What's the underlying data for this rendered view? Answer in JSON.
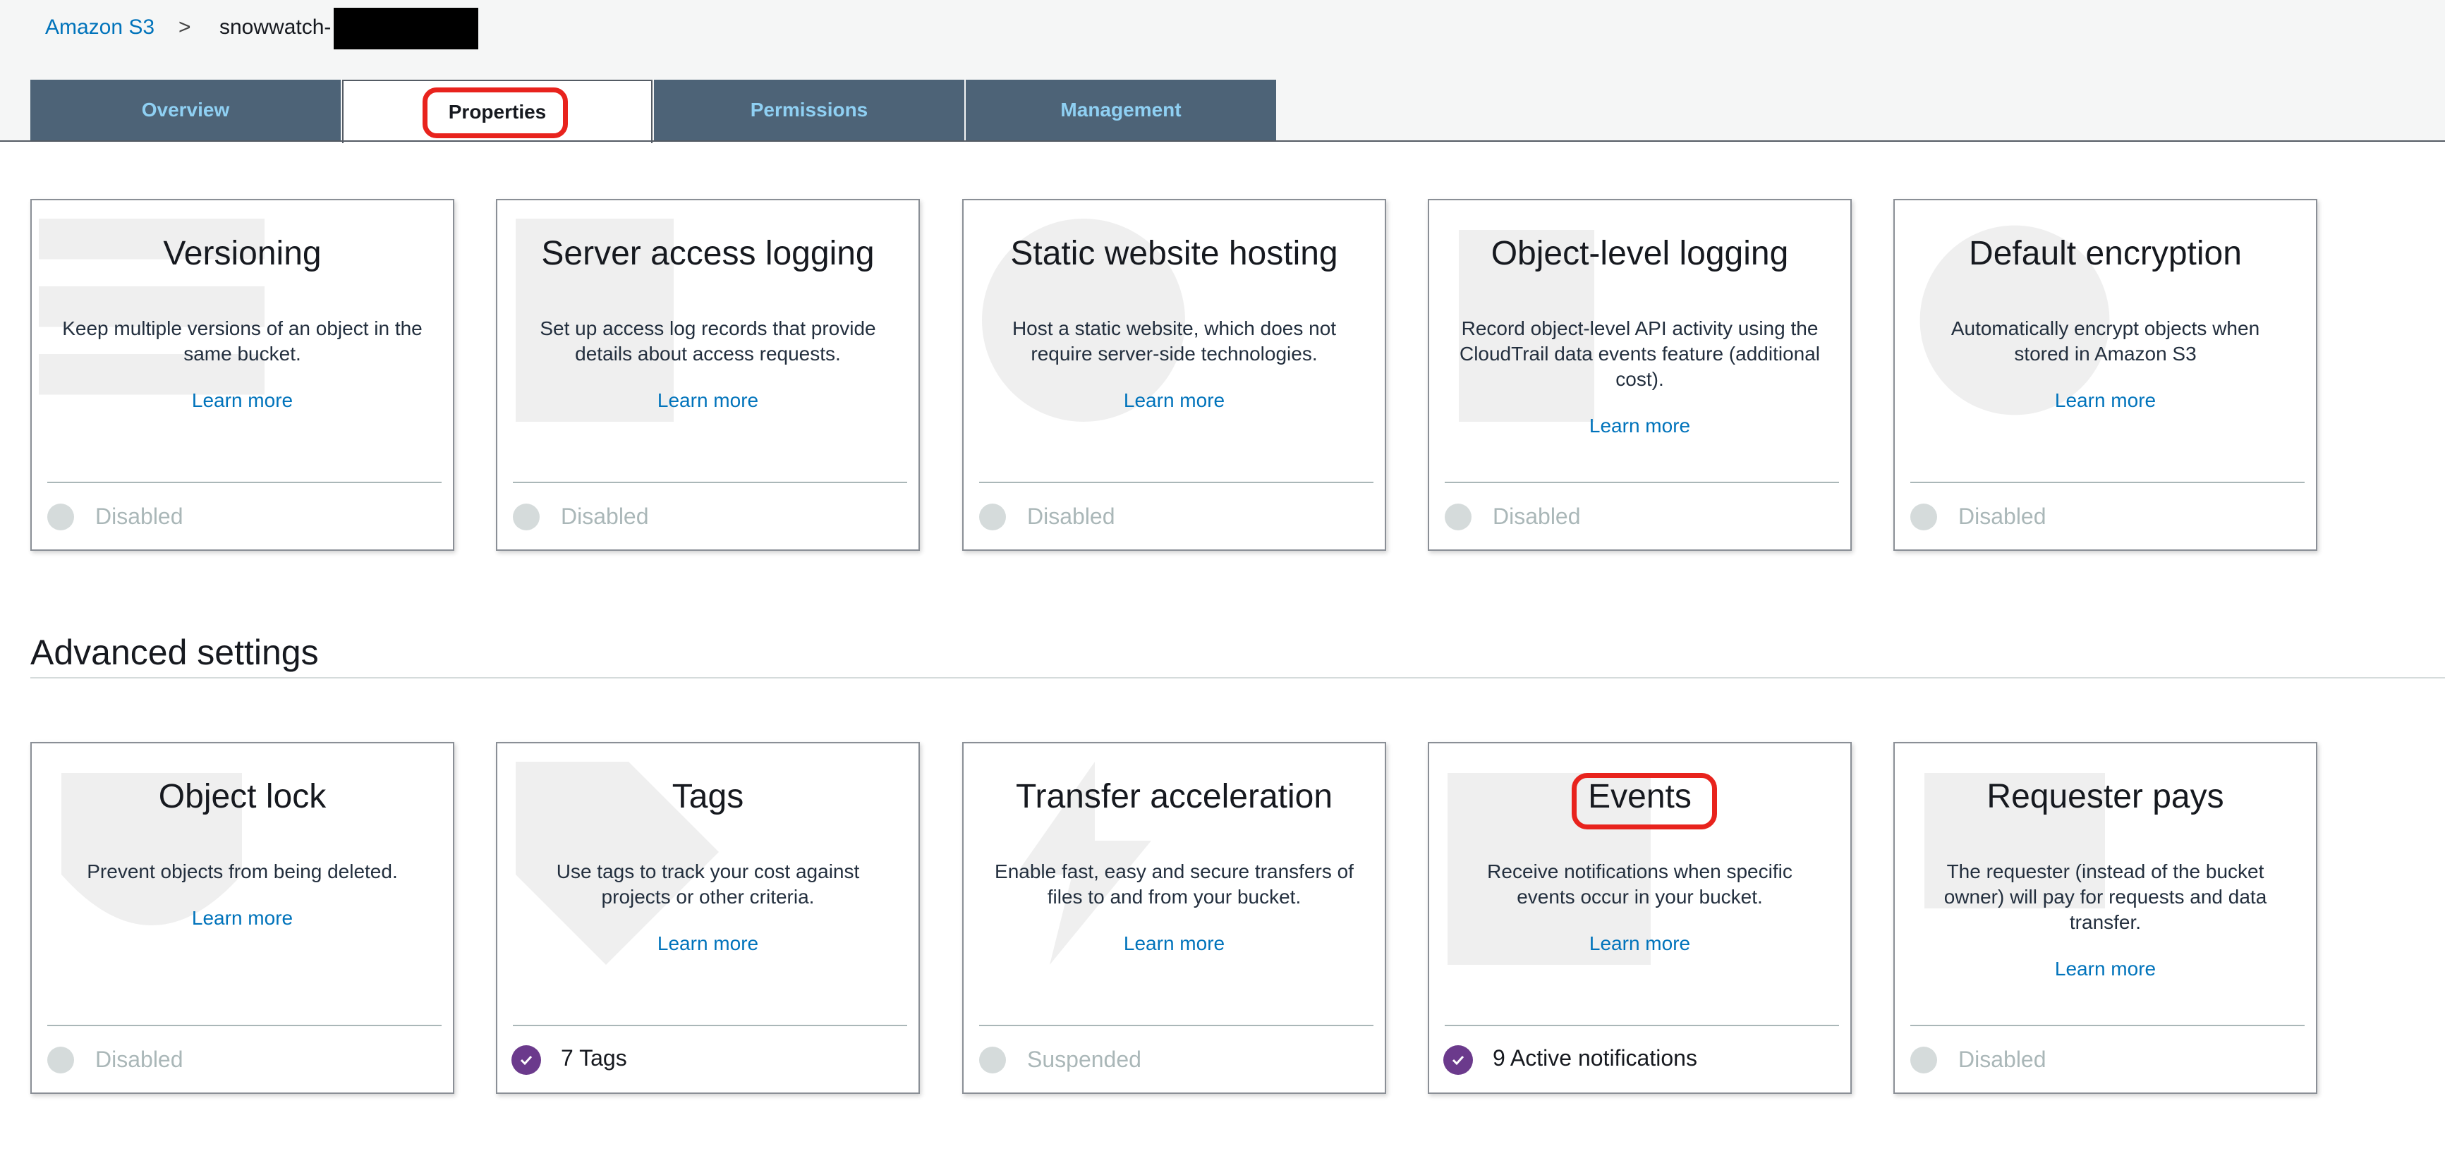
{
  "breadcrumb": {
    "root": "Amazon S3",
    "separator": ">",
    "bucket": "snowwatch-"
  },
  "tabs": [
    {
      "label": "Overview",
      "active": false
    },
    {
      "label": "Properties",
      "active": true
    },
    {
      "label": "Permissions",
      "active": false
    },
    {
      "label": "Management",
      "active": false
    }
  ],
  "cards": [
    {
      "title": "Versioning",
      "description": "Keep multiple versions of an object in the same bucket.",
      "link": "Learn more",
      "status": "Disabled",
      "enabled": false,
      "icon": "list-icon"
    },
    {
      "title": "Server access logging",
      "description": "Set up access log records that provide details about access requests.",
      "link": "Learn more",
      "status": "Disabled",
      "enabled": false,
      "icon": "log-file-icon"
    },
    {
      "title": "Static website hosting",
      "description": "Host a static website, which does not require server-side technologies.",
      "link": "Learn more",
      "status": "Disabled",
      "enabled": false,
      "icon": "globe-icon"
    },
    {
      "title": "Object-level logging",
      "description": "Record object-level API activity using the CloudTrail data events feature (additional cost).",
      "link": "Learn more",
      "status": "Disabled",
      "enabled": false,
      "icon": "clipboard-icon"
    },
    {
      "title": "Default encryption",
      "description": "Automatically encrypt objects when stored in Amazon S3",
      "link": "Learn more",
      "status": "Disabled",
      "enabled": false,
      "icon": "lock-icon"
    }
  ],
  "advanced": {
    "heading": "Advanced settings",
    "cards": [
      {
        "title": "Object lock",
        "description": "Prevent objects from being deleted.",
        "link": "Learn more",
        "status": "Disabled",
        "enabled": false,
        "icon": "shield-icon"
      },
      {
        "title": "Tags",
        "description": "Use tags to track your cost against projects or other criteria.",
        "link": "Learn more",
        "status": "7 Tags",
        "enabled": true,
        "icon": "tag-icon"
      },
      {
        "title": "Transfer acceleration",
        "description": "Enable fast, easy and secure transfers of files to and from your bucket.",
        "link": "Learn more",
        "status": "Suspended",
        "enabled": false,
        "icon": "lightning-icon"
      },
      {
        "title": "Events",
        "description": "Receive notifications when specific events occur in your bucket.",
        "link": "Learn more",
        "status": "9 Active notifications",
        "enabled": true,
        "icon": "calendar-icon"
      },
      {
        "title": "Requester pays",
        "description": "The requester (instead of the bucket owner) will pay for requests and data transfer.",
        "link": "Learn more",
        "status": "Disabled",
        "enabled": false,
        "icon": "money-icon"
      }
    ]
  },
  "colors": {
    "tab_bg": "#4d6377",
    "tab_text": "#8fd0f3",
    "link": "#0073bb",
    "enabled_check": "#6b3a8c",
    "highlight": "#e8231d"
  }
}
